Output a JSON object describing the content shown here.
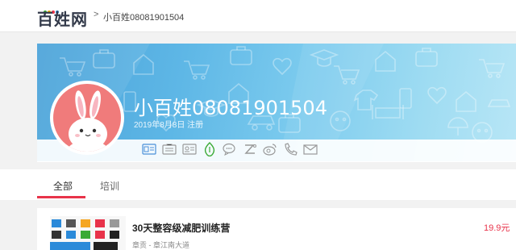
{
  "header": {
    "logo_text": "百姓网",
    "crumb_separator": ">",
    "breadcrumb": "小百姓08081901504",
    "logo_dot_colors": [
      "#3aaa35",
      "#f5b400",
      "#e8334a",
      "#2b8ad9"
    ]
  },
  "profile": {
    "username": "小百姓08081901504",
    "register_date": "2019年8月8日 注册",
    "badges": [
      "id-card-icon",
      "business-card-icon",
      "license-icon",
      "deposit-icon",
      "chat-icon",
      "sesame-credit-icon",
      "weibo-icon",
      "phone-icon",
      "email-icon"
    ]
  },
  "tabs": [
    {
      "label": "全部",
      "active": true
    },
    {
      "label": "培训",
      "active": false
    }
  ],
  "listing": {
    "title": "30天整容级减肥训练营",
    "address": "章贡 - 章江南大道",
    "price": "19.9元"
  },
  "colors": {
    "accent": "#e8334a",
    "banner": "#5eb7e6",
    "avatar_bg": "#f07b7b"
  }
}
